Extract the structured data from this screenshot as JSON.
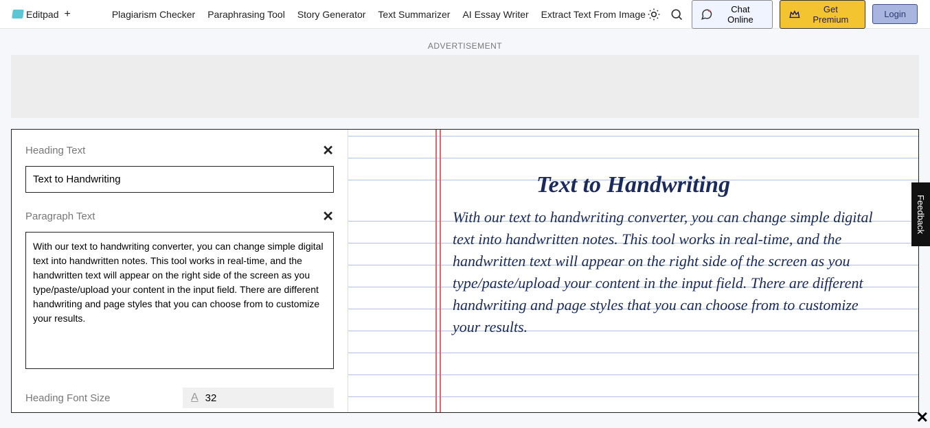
{
  "header": {
    "logo_text": "Editpad",
    "logo_plus": "+",
    "nav": [
      "Plagiarism Checker",
      "Paraphrasing Tool",
      "Story Generator",
      "Text Summarizer",
      "AI Essay Writer",
      "Extract Text From Image"
    ],
    "chat_label": "Chat Online",
    "premium_label": "Get Premium",
    "login_label": "Login"
  },
  "ad": {
    "label": "ADVERTISEMENT"
  },
  "editor": {
    "heading_label": "Heading Text",
    "heading_value": "Text to Handwriting",
    "paragraph_label": "Paragraph Text",
    "paragraph_value": "With our text to handwriting converter, you can change simple digital text into handwritten notes. This tool works in real-time, and the handwritten text will appear on the right side of the screen as you type/paste/upload your content in the input field. There are different handwriting and page styles that you can choose from to customize your results.",
    "font_size_label": "Heading Font Size",
    "font_size_value": "32"
  },
  "preview": {
    "heading": "Text to Handwriting",
    "body": "With our text to handwriting converter, you can change simple digital text into handwritten notes. This tool works in real-time, and the handwritten text will appear on the right side of the screen as you type/paste/upload your content in the input field. There are different handwriting and page styles that you can choose from to customize your results."
  },
  "feedback_label": "Feedback"
}
